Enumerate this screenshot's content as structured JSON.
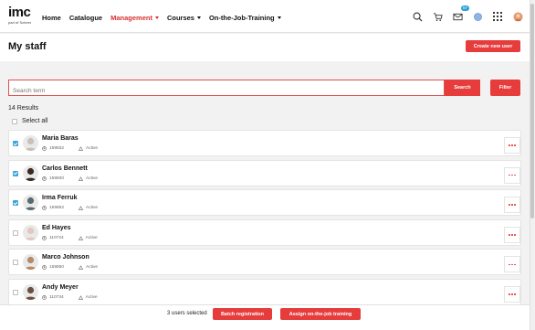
{
  "brand": {
    "logo": "imc",
    "sub": "part of Scheer"
  },
  "nav": [
    {
      "label": "Home",
      "caret": false,
      "active": false
    },
    {
      "label": "Catalogue",
      "caret": false,
      "active": false
    },
    {
      "label": "Management",
      "caret": true,
      "active": true
    },
    {
      "label": "Courses",
      "caret": true,
      "active": false
    },
    {
      "label": "On-the-Job-Training",
      "caret": true,
      "active": false
    }
  ],
  "icons": {
    "notifications_badge": "57"
  },
  "page": {
    "title": "My staff",
    "create_label": "Create new user"
  },
  "search": {
    "placeholder": "Search term",
    "search_label": "Search",
    "filter_label": "Filter"
  },
  "results": {
    "count_label": "14 Results",
    "select_all_label": "Select all"
  },
  "staff": [
    {
      "name": "Maria Baras",
      "id": "159832",
      "status": "Active",
      "checked": true,
      "avatar": "#c9c0b8"
    },
    {
      "name": "Carlos Bennett",
      "id": "159830",
      "status": "Active",
      "checked": true,
      "avatar": "#3a2a22"
    },
    {
      "name": "Irma Ferruk",
      "id": "159852",
      "status": "Active",
      "checked": true,
      "avatar": "#5a6a72"
    },
    {
      "name": "Ed Hayes",
      "id": "110724",
      "status": "Active",
      "checked": false,
      "avatar": "#e2c8bd"
    },
    {
      "name": "Marco Johnson",
      "id": "159850",
      "status": "Active",
      "checked": false,
      "avatar": "#b58a66"
    },
    {
      "name": "Andy Meyer",
      "id": "110734",
      "status": "Active",
      "checked": false,
      "avatar": "#6b4f3f"
    }
  ],
  "actionbar": {
    "selected_label": "3 users selected",
    "batch_label": "Batch registration",
    "assign_label": "Assign on-the-job training"
  },
  "colors": {
    "accent": "#e63c3c",
    "check": "#3ba4d8"
  }
}
